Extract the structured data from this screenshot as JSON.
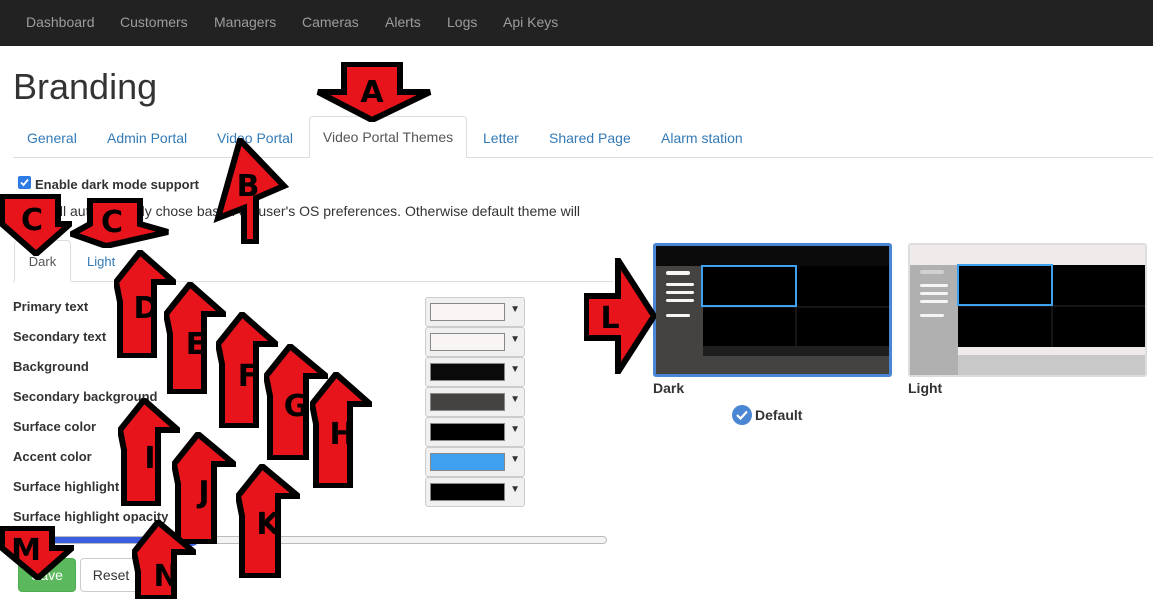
{
  "navbar": {
    "items": [
      "Dashboard",
      "Customers",
      "Managers",
      "Cameras",
      "Alerts",
      "Logs",
      "Api Keys"
    ]
  },
  "page": {
    "title": "Branding"
  },
  "tabs": {
    "items": [
      "General",
      "Admin Portal",
      "Video Portal",
      "Video Portal Themes",
      "Letter",
      "Shared Page",
      "Alarm station"
    ],
    "active": "Video Portal Themes"
  },
  "dark_mode": {
    "label": "Enable dark mode support",
    "checked": true,
    "description": "...will automatically chose based on user's OS preferences. Otherwise default theme will"
  },
  "theme_tabs": {
    "dark": "Dark",
    "light": "Light",
    "active": "Dark"
  },
  "fields": [
    {
      "label": "Primary text",
      "color": "#faf5f5"
    },
    {
      "label": "Secondary text",
      "color": "#faf5f5"
    },
    {
      "label": "Background",
      "color": "#0a0a0a"
    },
    {
      "label": "Secondary background",
      "color": "#454242"
    },
    {
      "label": "Surface color",
      "color": "#000000"
    },
    {
      "label": "Accent color",
      "color": "#3fa0ef"
    },
    {
      "label": "Surface highlight",
      "color": "#000000"
    }
  ],
  "opacity": {
    "label": "Surface highlight opacity",
    "value": 0.3
  },
  "buttons": {
    "save": "Save",
    "reset": "Reset"
  },
  "previews": {
    "dark": {
      "label": "Dark",
      "default_label": "Default",
      "is_default": true
    },
    "light": {
      "label": "Light"
    }
  },
  "callouts": [
    "A",
    "B",
    "C",
    "C",
    "D",
    "E",
    "F",
    "G",
    "H",
    "I",
    "J",
    "K",
    "L",
    "M",
    "N"
  ],
  "colors": {
    "callout_fill": "#e8141b",
    "callout_border": "#000000",
    "accent": "#337ab7",
    "preview_border": "#4a86d4"
  }
}
